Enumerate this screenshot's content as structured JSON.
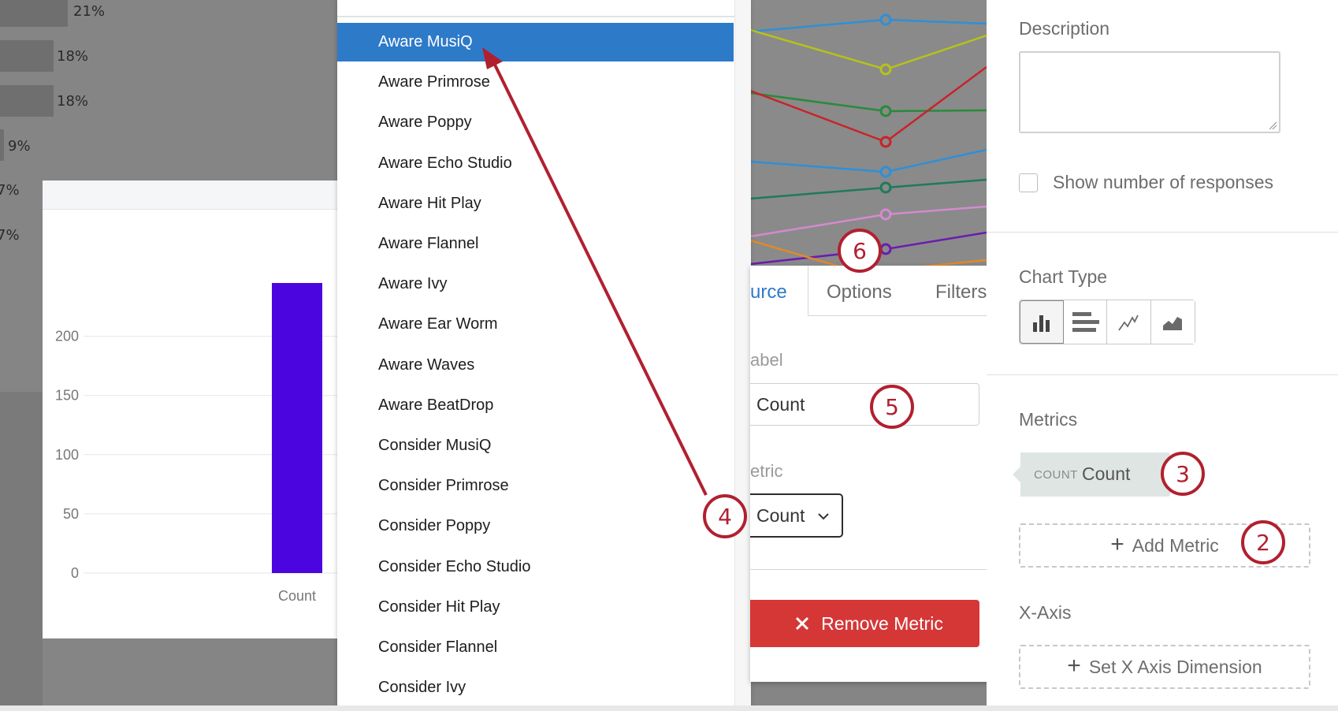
{
  "background_list": {
    "percentages": [
      "21%",
      "18%",
      "18%",
      "9%",
      "7%",
      "7%"
    ],
    "bar_fractions": [
      0.32,
      0.25,
      0.25,
      0.02,
      0.0,
      0.0
    ]
  },
  "chart": {
    "chart_data": {
      "type": "bar",
      "categories": [
        "Count"
      ],
      "values": [
        245
      ],
      "ylim": [
        0,
        245
      ],
      "yticks": [
        0,
        50,
        100,
        150,
        200
      ],
      "colors": [
        "#4b06e0"
      ]
    }
  },
  "dropdown": {
    "items": [
      "Aware MusiQ",
      "Aware Primrose",
      "Aware Poppy",
      "Aware Echo Studio",
      "Aware Hit Play",
      "Aware Flannel",
      "Aware Ivy",
      "Aware Ear Worm",
      "Aware Waves",
      "Aware BeatDrop",
      "Consider MusiQ",
      "Consider Primrose",
      "Consider Poppy",
      "Consider Echo Studio",
      "Consider Hit Play",
      "Consider Flannel",
      "Consider Ivy"
    ],
    "selected_index": 0,
    "selected_color": "#2d7ac9"
  },
  "popover": {
    "tabs": [
      "urce",
      "Options",
      "Filters"
    ],
    "active_tab": 0,
    "label_heading": "abel",
    "label_value": "Count",
    "metric_heading": "etric",
    "metric_value": "Count",
    "remove_label": "Remove Metric",
    "remove_color": "#d53737"
  },
  "sidebar": {
    "description_heading": "Description",
    "show_responses_label": "Show number of responses",
    "show_responses_checked": false,
    "chart_type_heading": "Chart Type",
    "chart_types": [
      "bar-chart-icon",
      "horizontal-bar-icon",
      "line-chart-icon",
      "area-chart-icon"
    ],
    "metrics_heading": "Metrics",
    "metric_pill_type": "COUNT",
    "metric_pill_name": "Count",
    "add_metric_label": "Add Metric",
    "x_axis_heading": "X-Axis",
    "set_x_axis_label": "Set X Axis Dimension"
  },
  "annotations": {
    "steps": [
      "2",
      "3",
      "4",
      "5",
      "6"
    ],
    "color": "#b1202f"
  }
}
